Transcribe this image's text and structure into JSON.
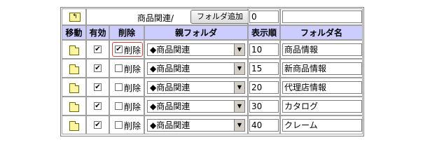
{
  "top": {
    "breadcrumb": "商品関連/",
    "add_folder_button": "フォルダ追加",
    "order_value": "0",
    "name_value": ""
  },
  "headers": {
    "move": "移動",
    "enabled": "有効",
    "delete": "削除",
    "parent": "親フォルダ",
    "order": "表示順",
    "name": "フォルダ名"
  },
  "delete_label": "削除",
  "rows": [
    {
      "enabled": true,
      "delete": true,
      "parent": "◆商品関連",
      "order": "10",
      "name": "商品情報"
    },
    {
      "enabled": true,
      "delete": false,
      "parent": "◆商品関連",
      "order": "15",
      "name": "新商品情報"
    },
    {
      "enabled": true,
      "delete": false,
      "parent": "◆商品関連",
      "order": "20",
      "name": "代理店情報"
    },
    {
      "enabled": true,
      "delete": false,
      "parent": "◆商品関連",
      "order": "30",
      "name": "カタログ"
    },
    {
      "enabled": true,
      "delete": false,
      "parent": "◆商品関連",
      "order": "40",
      "name": "クレーム"
    }
  ]
}
